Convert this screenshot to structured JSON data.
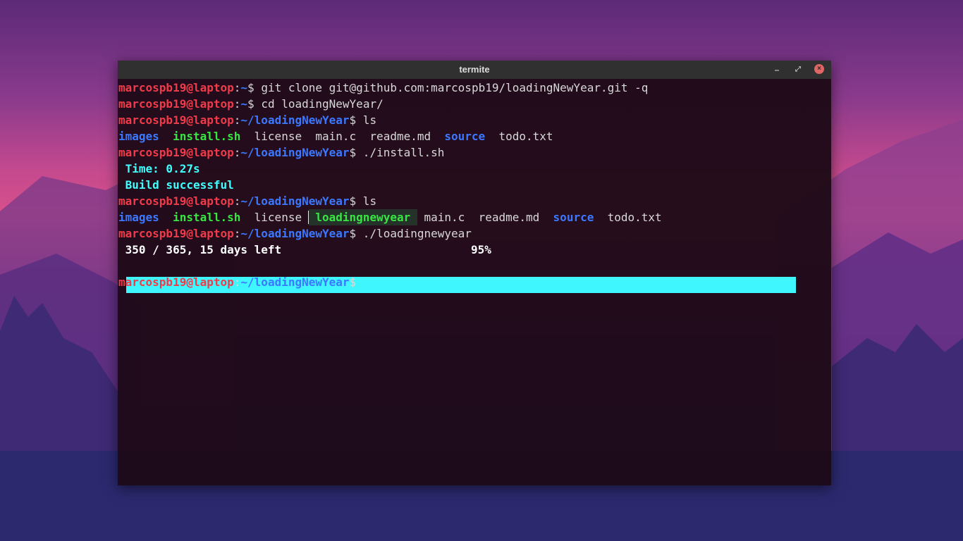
{
  "window": {
    "title": "termite"
  },
  "prompt": {
    "user_host": "marcospb19@laptop",
    "home": "~",
    "repo_dir": "~/loadingNewYear",
    "symbol": "$"
  },
  "commands": {
    "clone": " git clone git@github.com:marcospb19/loadingNewYear.git -q",
    "cd": " cd loadingNewYear/",
    "ls": " ls",
    "install": " ./install.sh",
    "run": " ./loadingnewyear"
  },
  "ls1": [
    "images",
    "install.sh",
    "license",
    "main.c",
    "readme.md",
    "source",
    "todo.txt"
  ],
  "ls2": [
    "images",
    "install.sh",
    "license",
    "loadingnewyear",
    "main.c",
    "readme.md",
    "source",
    "todo.txt"
  ],
  "install_output": {
    "time": " Time: 0.27s",
    "build": " Build successful"
  },
  "progress": {
    "text": " 350 / 365, 15 days left",
    "percent_text": "95%",
    "value": 0.95,
    "color": "#3ff6ff"
  },
  "colors": {
    "user": "#ef3b4a",
    "path": "#3c78ff",
    "exec": "#37e641",
    "cyan": "#40ffff"
  }
}
